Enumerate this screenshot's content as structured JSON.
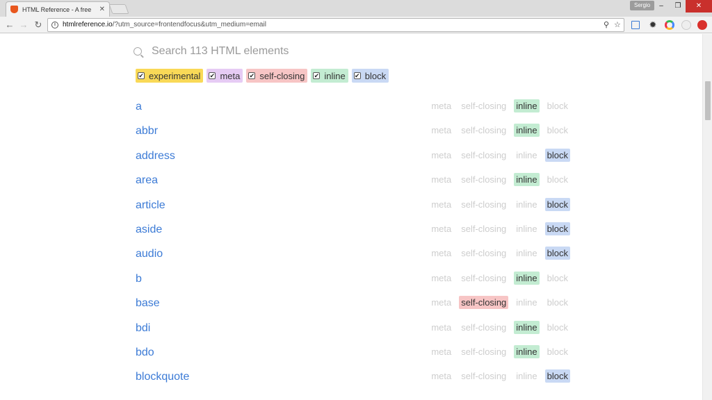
{
  "browser": {
    "tab_title": "HTML Reference - A free",
    "profile_name": "Sergio",
    "url_host": "htmlreference.io",
    "url_path": "/?utm_source=frontendfocus&utm_medium=email"
  },
  "search": {
    "placeholder": "Search 113 HTML elements",
    "value": ""
  },
  "colors": {
    "experimental": "#f9d957",
    "meta": "#e6cbf4",
    "self-closing": "#f7c5c5",
    "inline": "#c3ecd2",
    "block": "#c9d9f4",
    "link": "#3c7bd6"
  },
  "filters": [
    {
      "key": "experimental",
      "label": "experimental",
      "checked": true
    },
    {
      "key": "meta",
      "label": "meta",
      "checked": true
    },
    {
      "key": "self-closing",
      "label": "self-closing",
      "checked": true
    },
    {
      "key": "inline",
      "label": "inline",
      "checked": true
    },
    {
      "key": "block",
      "label": "block",
      "checked": true
    }
  ],
  "tag_labels": [
    "meta",
    "self-closing",
    "inline",
    "block"
  ],
  "elements": [
    {
      "name": "a",
      "active": [
        "inline"
      ]
    },
    {
      "name": "abbr",
      "active": [
        "inline"
      ]
    },
    {
      "name": "address",
      "active": [
        "block"
      ]
    },
    {
      "name": "area",
      "active": [
        "inline"
      ]
    },
    {
      "name": "article",
      "active": [
        "block"
      ]
    },
    {
      "name": "aside",
      "active": [
        "block"
      ]
    },
    {
      "name": "audio",
      "active": [
        "block"
      ]
    },
    {
      "name": "b",
      "active": [
        "inline"
      ]
    },
    {
      "name": "base",
      "active": [
        "self-closing"
      ]
    },
    {
      "name": "bdi",
      "active": [
        "inline"
      ]
    },
    {
      "name": "bdo",
      "active": [
        "inline"
      ]
    },
    {
      "name": "blockquote",
      "active": [
        "block"
      ]
    }
  ]
}
